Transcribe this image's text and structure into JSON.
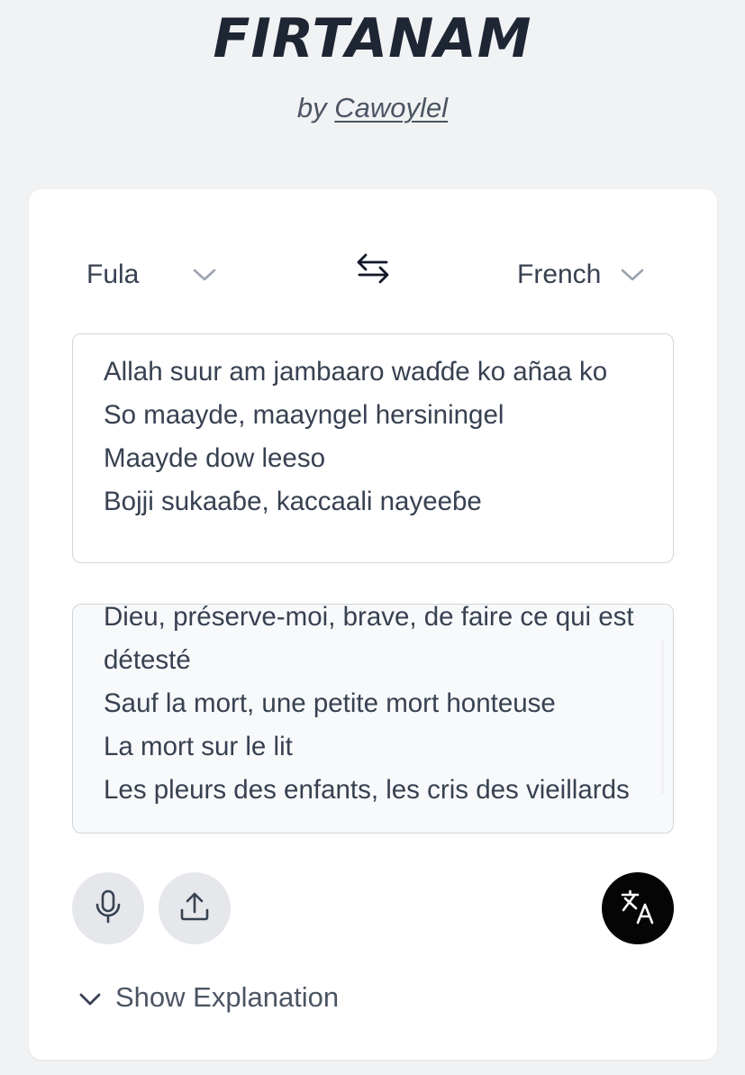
{
  "header": {
    "logo": "FIRTANAM",
    "by_prefix": "by",
    "author": "Cawoylel"
  },
  "languages": {
    "source": "Fula",
    "target": "French"
  },
  "input": {
    "text": "Allah suur am jambaaro waɗɗe ko añaa ko\nSo maayde, maayngel hersiningel\nMaayde dow leeso\nBojji sukaaɓe, kaccaali nayeeɓe"
  },
  "output": {
    "text": "Dieu, préserve-moi, brave, de faire ce qui est détesté\nSauf la mort, une petite mort honteuse\nLa mort sur le lit\nLes pleurs des enfants, les cris des vieillards"
  },
  "explanation": {
    "toggle_label": "Show Explanation"
  },
  "icons": {
    "swap": "swap-arrows-icon",
    "mic": "microphone-icon",
    "upload": "upload-icon",
    "translate": "translate-icon",
    "chevron": "chevron-down-icon"
  },
  "colors": {
    "background": "#f1f2f4",
    "card": "#ffffff",
    "logo": "#1e2533",
    "text": "#374151",
    "translate_button": "#050505",
    "round_button": "#e5e7eb"
  }
}
